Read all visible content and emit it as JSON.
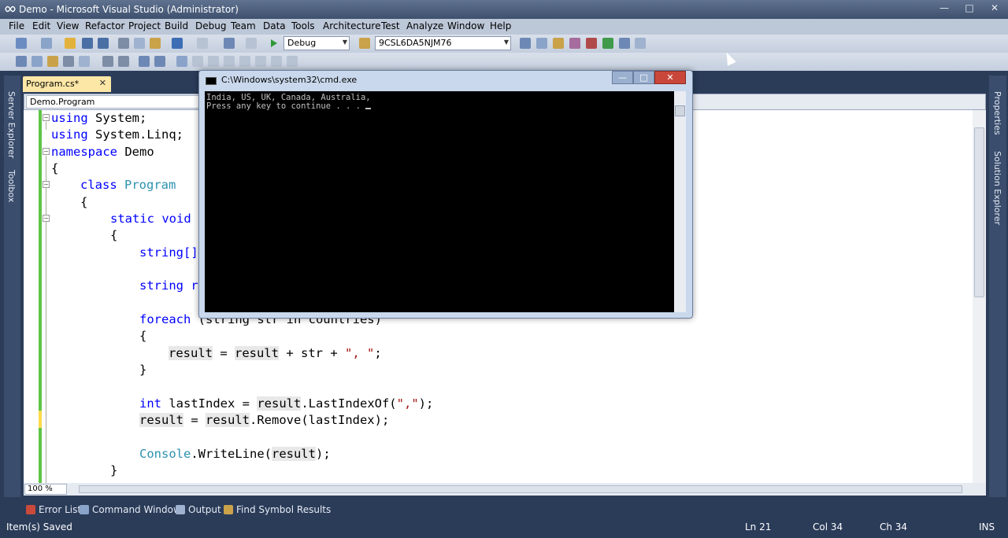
{
  "window": {
    "title": "Demo - Microsoft Visual Studio (Administrator)"
  },
  "menu": [
    "File",
    "Edit",
    "View",
    "Refactor",
    "Project",
    "Build",
    "Debug",
    "Team",
    "Data",
    "Tools",
    "Architecture",
    "Test",
    "Analyze",
    "Window",
    "Help"
  ],
  "toolbar": {
    "config": "Debug",
    "platform": "9CSL6DA5NJM76"
  },
  "side_tabs": {
    "left": [
      "Server Explorer",
      "Toolbox"
    ],
    "right": [
      "Properties",
      "Solution Explorer"
    ]
  },
  "document": {
    "tab": "Program.cs*",
    "nav": "Demo.Program",
    "zoom": "100 %"
  },
  "code": {
    "l1a": "using",
    "l1b": " System;",
    "l2a": "using",
    "l2b": " System.Linq;",
    "l3a": "namespace",
    "l3b": " Demo",
    "l4": "{",
    "l5a": "class",
    "l5b": "Program",
    "l6": "{",
    "l7a": "static",
    "l7b": "void",
    "l8": "{",
    "l9": "string[]",
    "l10": "string r",
    "l11a": "foreach",
    "l11b": " (string str in countries)",
    "l12": "{",
    "l13a": "result",
    "l13b": " = ",
    "l13c": "result",
    "l13d": " + str + ",
    "l13e": "\", \"",
    "l13f": ";",
    "l14": "}",
    "l15a": "int",
    "l15b": " lastIndex = ",
    "l15c": "result",
    "l15d": ".LastIndexOf(",
    "l15e": "\",\"",
    "l15f": ");",
    "l16a": "result",
    "l16b": " = ",
    "l16c": "result",
    "l16d": ".Remove(lastIndex);",
    "l17a": "Console",
    "l17b": ".WriteLine(",
    "l17c": "result",
    "l17d": ");",
    "l18": "}"
  },
  "cmd": {
    "title": "C:\\Windows\\system32\\cmd.exe",
    "line1": "India, US, UK, Canada, Australia,",
    "line2": "Press any key to continue . . . "
  },
  "bottom_tabs": [
    "Error List",
    "Command Window",
    "Output",
    "Find Symbol Results"
  ],
  "status": {
    "message": "Item(s) Saved",
    "ln": "Ln 21",
    "col": "Col 34",
    "ch": "Ch 34",
    "mode": "INS"
  },
  "colors": {
    "keyword": "#0000ff",
    "type": "#2b91af",
    "string": "#a31515",
    "chrome": "#2b3c59"
  }
}
